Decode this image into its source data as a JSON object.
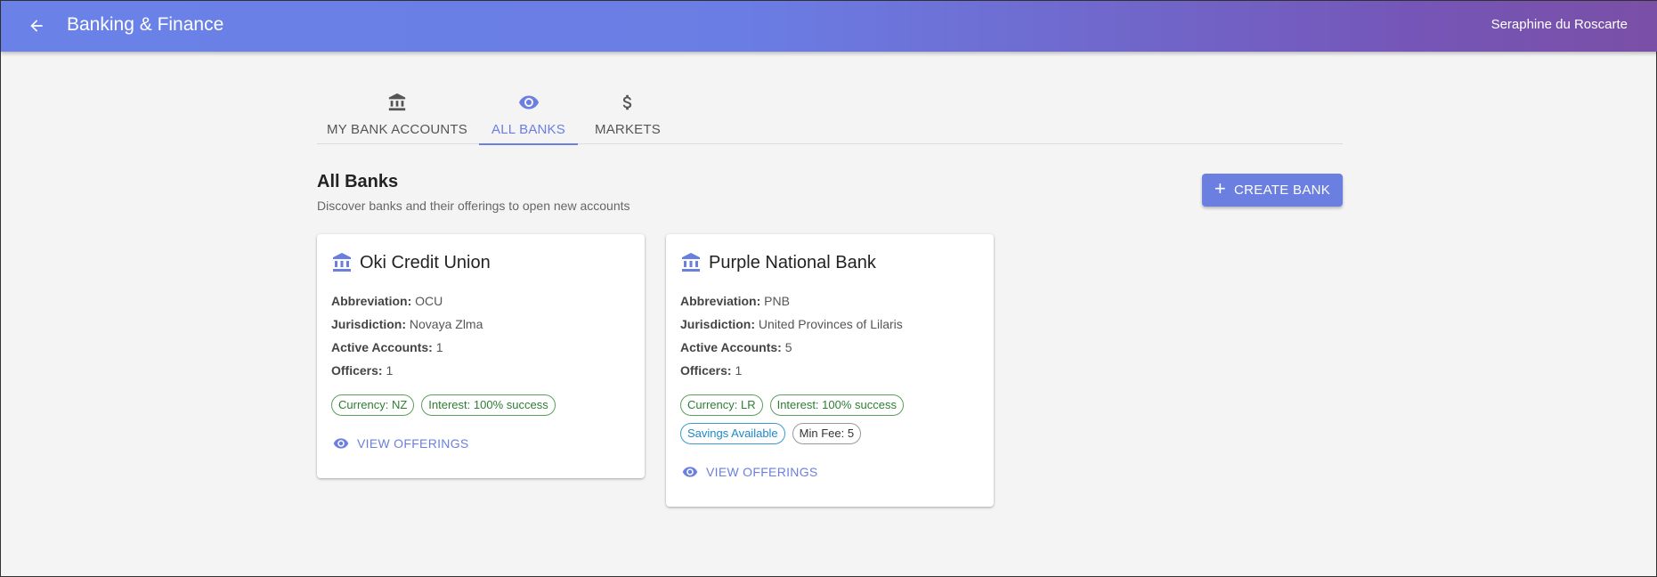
{
  "appbar": {
    "title": "Banking & Finance",
    "user": "Seraphine du Roscarte",
    "back_icon": "arrow-left-icon"
  },
  "tabs": [
    {
      "label": "MY BANK ACCOUNTS",
      "icon": "bank-icon",
      "active": false
    },
    {
      "label": "ALL BANKS",
      "icon": "eye-icon",
      "active": true
    },
    {
      "label": "MARKETS",
      "icon": "dollar-icon",
      "active": false
    }
  ],
  "section": {
    "title": "All Banks",
    "subtitle": "Discover banks and their offerings to open new accounts"
  },
  "create_button": {
    "label": "CREATE BANK",
    "icon": "plus-icon"
  },
  "banks": [
    {
      "name": "Oki Credit Union",
      "fields": [
        {
          "label": "Abbreviation:",
          "value": "OCU"
        },
        {
          "label": "Jurisdiction:",
          "value": "Novaya Zlma"
        },
        {
          "label": "Active Accounts:",
          "value": "1"
        },
        {
          "label": "Officers:",
          "value": "1"
        }
      ],
      "chips": [
        {
          "text": "Currency: NZ",
          "style": "green"
        },
        {
          "text": "Interest: 100% success",
          "style": "green"
        }
      ],
      "action": "VIEW OFFERINGS"
    },
    {
      "name": "Purple National Bank",
      "fields": [
        {
          "label": "Abbreviation:",
          "value": "PNB"
        },
        {
          "label": "Jurisdiction:",
          "value": "United Provinces of Lilaris"
        },
        {
          "label": "Active Accounts:",
          "value": "5"
        },
        {
          "label": "Officers:",
          "value": "1"
        }
      ],
      "chips": [
        {
          "text": "Currency: LR",
          "style": "green"
        },
        {
          "text": "Interest: 100% success",
          "style": "green"
        },
        {
          "text": "Savings Available",
          "style": "blue"
        },
        {
          "text": "Min Fee: 5",
          "style": "gray"
        }
      ],
      "action": "VIEW OFFERINGS"
    }
  ],
  "colors": {
    "accent": "#6b7fe0",
    "appbar_start": "#6a82e8",
    "appbar_end": "#7a4fa6",
    "chip_green": "#2e7d32",
    "chip_blue": "#1e88c8"
  }
}
